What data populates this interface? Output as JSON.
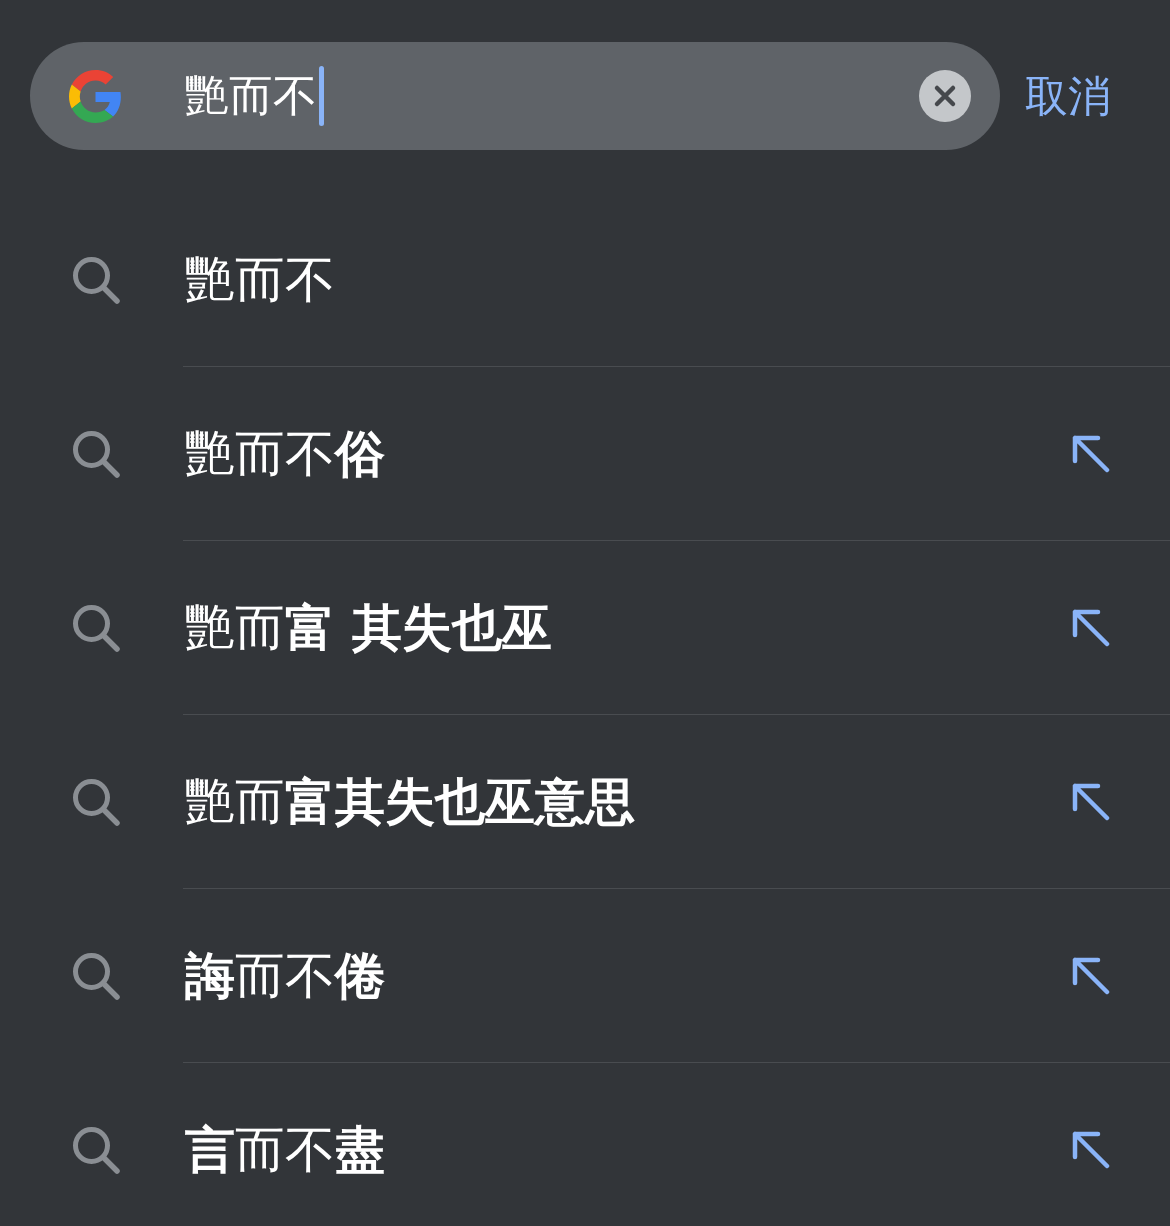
{
  "search": {
    "value": "艷而不",
    "cancel": "取消"
  },
  "suggestions": [
    {
      "text": "艷而不",
      "kind": "query"
    },
    {
      "text": "艷而不**俗**",
      "kind": "completion"
    },
    {
      "text": "艷而**富 其失也巫**",
      "kind": "completion"
    },
    {
      "text": "艷而**富其失也巫意思**",
      "kind": "completion"
    },
    {
      "text": "**誨**而不**倦**",
      "kind": "completion"
    },
    {
      "text": "**言**而不**盡**",
      "kind": "completion"
    }
  ]
}
